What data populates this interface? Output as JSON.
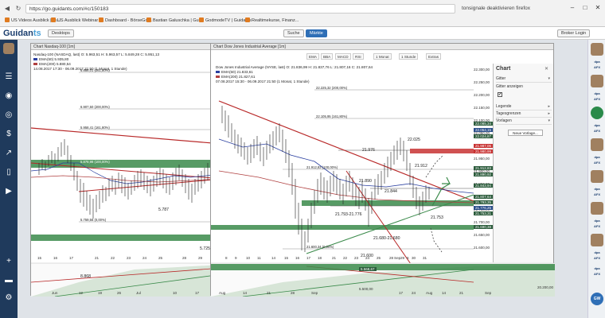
{
  "browser": {
    "url": "https://go.guidants.com/#c/150183",
    "tracking_note": "tonsignale deaktivieren firefox",
    "bookmarks": [
      "US Videos Ausblick | Gu...",
      "US Ausblick Webinar |...",
      "Dashboard - BörseGo ...",
      "Bastian Galuschka | Gu...",
      "GodmodeTV | Guidants",
      "Realtimekurse, Finanz..."
    ]
  },
  "app": {
    "logo_main": "Guidan",
    "logo_accent": "ts",
    "desktops_label": "Desktops",
    "search_label": "Suche",
    "market_label": "Märkte",
    "broker_label": "Broker Login"
  },
  "left_chart": {
    "title": "Chart Nasdaq-100 [1m]",
    "legend": [
      {
        "text": "Nasdaq-100 (NASDAQ, last)  O: 5.963,51  H: 5.963,57  L: 5.849,28  C: 5.951,13",
        "color": "#222222"
      },
      {
        "text": "EMA(50)  5.935,80",
        "color": "#2a3fa0"
      },
      {
        "text": "EMA(200)  5.880,54",
        "color": "#b04040"
      },
      {
        "text": "14.08.2017 17:30 - 06.09.2017 21:50 (1 Monat, 1 Stunde)",
        "color": "#222222"
      }
    ],
    "levels": [
      {
        "label": "6.886,01 (261,80%)"
      },
      {
        "label": "6.907,50 (200,00%)"
      },
      {
        "label": "5.958,41 (161,80%)"
      },
      {
        "label": "5.878,98 (100,00%)"
      },
      {
        "label": "5.759,56 (0,00%)"
      }
    ],
    "annotations": [
      "5.787",
      "8.868",
      "5.725"
    ],
    "x_labels": [
      "15",
      "16",
      "17",
      "21",
      "22",
      "23",
      "24",
      "25",
      "28",
      "29",
      "30"
    ],
    "lower_x_labels": [
      "Jun",
      "12",
      "19",
      "26",
      "Jul",
      "10",
      "17"
    ]
  },
  "main_chart": {
    "title": "Chart Dow Jones Industrial Average [1m]",
    "toolbar": [
      "EMA",
      "BBA",
      "MACD",
      "RSI",
      "1 Monat",
      "1 Stunde",
      "Extras"
    ],
    "legend": [
      {
        "text": "Dow Jones Industrial Average (NYSE, last)  O: 21.836,99  H: 21.837,76  L: 21.807,16  C: 21.807,64",
        "color": "#222222"
      },
      {
        "text": "EMA(50)  21.833,61",
        "color": "#2a3fa0"
      },
      {
        "text": "EMA(200)  21.827,61",
        "color": "#b04040"
      },
      {
        "text": "07.08.2017 15:30 - 06.09.2017 21:50 (1 Monat, 1 Stunde)",
        "color": "#222222"
      }
    ],
    "fib_levels": [
      {
        "label": "22.225,32 (200,00%)"
      },
      {
        "label": "22.105,95 (161,80%)"
      },
      {
        "label": "21.912,83 (100,00%)"
      },
      {
        "label": "21.600,34 (0,00%)"
      }
    ],
    "y_axis": [
      "22.300,00",
      "22.250,00",
      "22.200,00",
      "22.150,00",
      "22.100,00",
      "22.050,00",
      "22.000,00",
      "21.950,00",
      "21.900,00",
      "21.850,00",
      "21.800,00",
      "21.750,00",
      "21.700,00",
      "21.650,00",
      "21.600,00"
    ],
    "y_boxes": [
      {
        "text": "22.085,34",
        "kind": "green"
      },
      {
        "text": "22.054,15",
        "kind": "blue"
      },
      {
        "text": "22.024,87",
        "kind": "green"
      },
      {
        "text": "21.987,06",
        "kind": "red"
      },
      {
        "text": "21.980,99",
        "kind": "red"
      },
      {
        "text": "21.912,83",
        "kind": "green"
      },
      {
        "text": "21.890,92",
        "kind": "green"
      },
      {
        "text": "21.843,94",
        "kind": "green"
      },
      {
        "text": "21.807,64",
        "kind": "green"
      },
      {
        "text": "21.793,35",
        "kind": "green"
      },
      {
        "text": "21.776,25",
        "kind": "blue"
      },
      {
        "text": "21.753,31",
        "kind": "green"
      },
      {
        "text": "21.690,38",
        "kind": "green"
      }
    ],
    "annotations": [
      "21.976",
      "22.025",
      "21.912",
      "21.890",
      "21.844",
      "21.793-21.776",
      "21.753",
      "21.680-21.680",
      "21.600"
    ],
    "x_labels": [
      "8",
      "9",
      "10",
      "11",
      "14",
      "15",
      "16",
      "17",
      "18",
      "21",
      "22",
      "23",
      "24",
      "25",
      "28",
      "29",
      "30",
      "31",
      "Sep",
      "6"
    ],
    "lower_x_labels": [
      "Aug",
      "14",
      "21",
      "28",
      "Sep",
      "17",
      "24",
      "Aug",
      "14",
      "21",
      "Sep"
    ],
    "lower_values": [
      "5.500,00",
      "5.568,67",
      "20.200,00"
    ]
  },
  "panel": {
    "title": "Chart",
    "sections": [
      "Gitter",
      "Gitter anzeigen",
      "Legende",
      "Tagesgrenzen",
      "Vorlagen"
    ],
    "gitter_checked": "✔",
    "new_template_label": "Neue Vorlage..."
  },
  "right_sidebar": {
    "items": [
      "dpa AFX",
      "dpa AFX",
      "dpa AFX",
      "dpa AFX",
      "dpa AFX",
      "dpa AFX",
      "dpa AFX"
    ],
    "circle_label": "GW"
  },
  "colors": {
    "sidebar": "#1f3a5c",
    "accent": "#2f6fb6",
    "up_candle": "#222222",
    "resistance_red": "#c83232",
    "support_green": "#3a8a4a"
  }
}
